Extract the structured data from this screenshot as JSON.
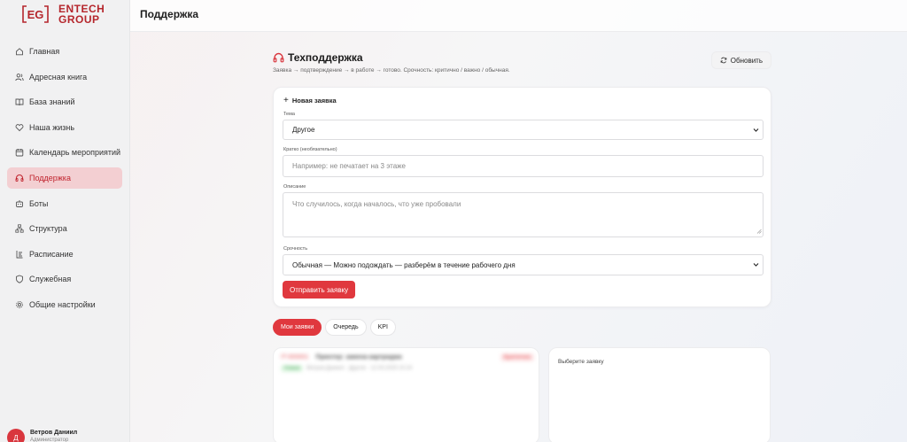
{
  "brand": {
    "mark": "EG",
    "line1": "ENTECH",
    "line2": "GROUP",
    "color": "#b5262c"
  },
  "accent": "#e0383e",
  "sidebar": {
    "items": [
      {
        "label": "Главная",
        "icon": "home-icon"
      },
      {
        "label": "Адресная книга",
        "icon": "users-icon"
      },
      {
        "label": "База знаний",
        "icon": "book-icon"
      },
      {
        "label": "Наша жизнь",
        "icon": "heart-icon"
      },
      {
        "label": "Календарь мероприятий",
        "icon": "calendar-icon"
      },
      {
        "label": "Поддержка",
        "icon": "headphones-icon",
        "active": true
      },
      {
        "label": "Боты",
        "icon": "bot-icon"
      },
      {
        "label": "Структура",
        "icon": "structure-icon"
      },
      {
        "label": "Расписание",
        "icon": "schedule-icon"
      },
      {
        "label": "Служебная",
        "icon": "shield-icon"
      },
      {
        "label": "Общие настройки",
        "icon": "gear-icon"
      }
    ]
  },
  "user": {
    "initial": "Д",
    "name": "Ветров Даниил",
    "role": "Администратор"
  },
  "topbar": {
    "title": "Поддержка"
  },
  "main": {
    "title": "Техподдержка",
    "subtitle": "Заявка → подтверждение → в работе → готово. Срочность: критично / важно / обычная.",
    "refresh_label": "Обновить"
  },
  "form": {
    "title": "Новая заявка",
    "topic_label": "Тема",
    "topic_value": "Другое",
    "summary_label": "Кратко (необязательно)",
    "summary_placeholder": "Например: не печатает на 3 этаже",
    "description_label": "Описание",
    "description_placeholder": "Что случилось, когда началось, что уже пробовали",
    "urgency_label": "Срочность",
    "urgency_value": "Обычная — Можно подождать — разберём в течение рабочего дня",
    "submit_label": "Отправить заявку"
  },
  "tabs": [
    {
      "label": "Мои заявки",
      "active": true
    },
    {
      "label": "Очередь"
    },
    {
      "label": "KPI"
    }
  ],
  "list": {
    "row": {
      "id": "IT-000001",
      "title": "Принтер: замена картриджа",
      "status": "Критично",
      "badge": "Новая",
      "meta": "Ветров Даниил · Другое · 12.03.2025 10:24"
    }
  },
  "detail": {
    "placeholder": "Выберите заявку"
  }
}
